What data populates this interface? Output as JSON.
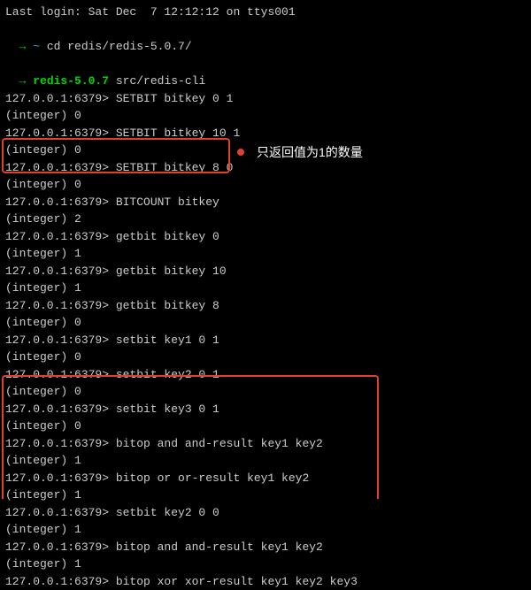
{
  "login_line": "Last login: Sat Dec  7 12:12:12 on ttys001",
  "prompt1_arrow": "→ ",
  "prompt1_tilde": "~ ",
  "prompt1_cmd": "cd redis/redis-5.0.7/",
  "prompt2_arrow": "→ ",
  "prompt2_dir": "redis-5.0.7 ",
  "prompt2_cmd": "src/redis-cli",
  "annotation_text": "只返回值为1的数量",
  "lines": [
    "127.0.0.1:6379> SETBIT bitkey 0 1",
    "(integer) 0",
    "127.0.0.1:6379> SETBIT bitkey 10 1",
    "(integer) 0",
    "127.0.0.1:6379> SETBIT bitkey 8 0",
    "(integer) 0",
    "127.0.0.1:6379> BITCOUNT bitkey",
    "(integer) 2",
    "127.0.0.1:6379> getbit bitkey 0",
    "(integer) 1",
    "127.0.0.1:6379> getbit bitkey 10",
    "(integer) 1",
    "127.0.0.1:6379> getbit bitkey 8",
    "(integer) 0",
    "127.0.0.1:6379> setbit key1 0 1",
    "(integer) 0",
    "127.0.0.1:6379> setbit key2 0 1",
    "(integer) 0",
    "127.0.0.1:6379> setbit key3 0 1",
    "(integer) 0",
    "127.0.0.1:6379> bitop and and-result key1 key2",
    "(integer) 1",
    "127.0.0.1:6379> bitop or or-result key1 key2",
    "(integer) 1",
    "127.0.0.1:6379> setbit key2 0 0",
    "(integer) 1",
    "127.0.0.1:6379> bitop and and-result key1 key2",
    "(integer) 1",
    "127.0.0.1:6379> bitop xor xor-result key1 key2 key3"
  ]
}
